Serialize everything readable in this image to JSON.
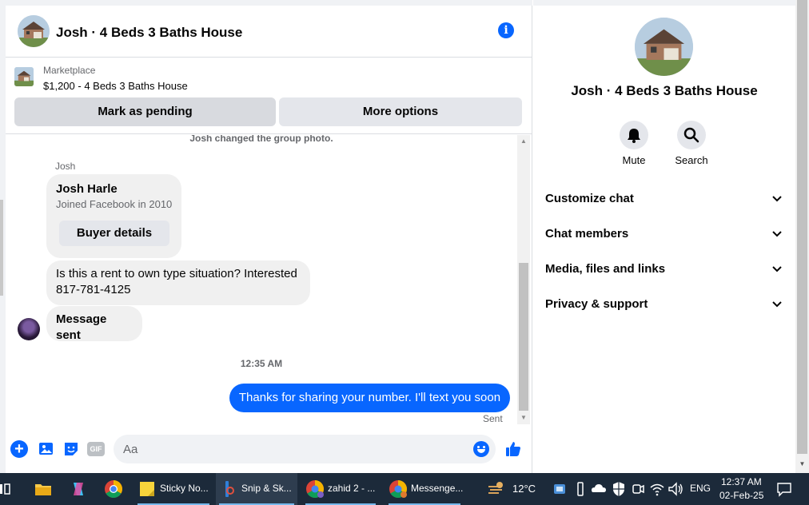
{
  "chat": {
    "title": "Josh · 4 Beds 3 Baths House",
    "marketplace_label": "Marketplace",
    "listing": "$1,200 - 4 Beds 3 Baths House",
    "mark_pending_label": "Mark as pending",
    "more_options_label": "More options"
  },
  "messages": {
    "system_notice": "Josh changed the group photo.",
    "sender_name": "Josh",
    "profile_card": {
      "name": "Josh Harle",
      "joined": "Joined Facebook in 2010",
      "button": "Buyer details"
    },
    "incoming": [
      "Is this a rent to own type situation? Interested 817-781-4125",
      "Message sent"
    ],
    "timestamp": "12:35 AM",
    "outgoing": "Thanks for sharing your number. I'll text you soon",
    "status": "Sent"
  },
  "composer": {
    "placeholder": "Aa",
    "gif_label": "GIF"
  },
  "info": {
    "title": "Josh · 4 Beds 3 Baths House",
    "mute_label": "Mute",
    "search_label": "Search",
    "sections": [
      "Customize chat",
      "Chat members",
      "Media, files and links",
      "Privacy & support"
    ]
  },
  "taskbar": {
    "apps": [
      "Sticky No...",
      "Snip & Sk...",
      "zahid 2 - ...",
      "Messenge..."
    ],
    "temperature": "12°C",
    "language": "ENG",
    "time": "12:37 AM",
    "date": "02-Feb-25"
  },
  "colors": {
    "accent": "#0866ff",
    "taskbar": "#1c2a3a"
  }
}
